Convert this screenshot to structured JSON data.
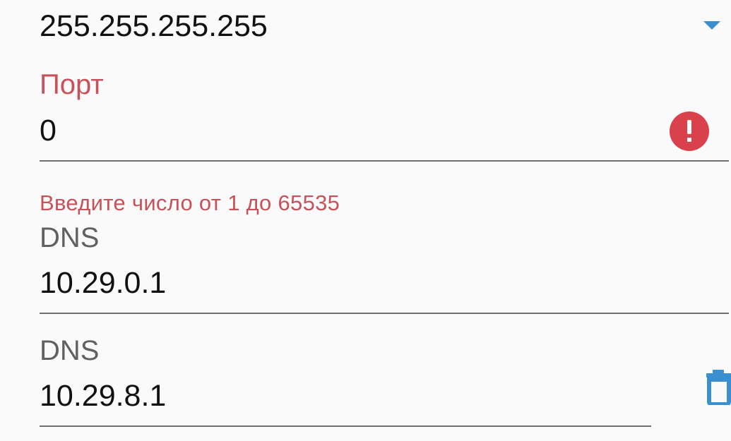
{
  "netmask": {
    "value": "255.255.255.255"
  },
  "port": {
    "label": "Порт",
    "value": "0",
    "error_text": "Введите число от 1 до 65535"
  },
  "dns_primary": {
    "label": "DNS",
    "value": "10.29.0.1"
  },
  "dns_secondary": {
    "label": "DNS",
    "value": "10.29.8.1"
  },
  "colors": {
    "error": "#c6535a",
    "error_badge": "#d9414d",
    "accent": "#3a8fd0",
    "label": "#616161",
    "underline": "#6e6e6e"
  },
  "icons": {
    "dropdown": "dropdown-arrow-icon",
    "error": "error-icon",
    "delete": "trash-icon"
  }
}
